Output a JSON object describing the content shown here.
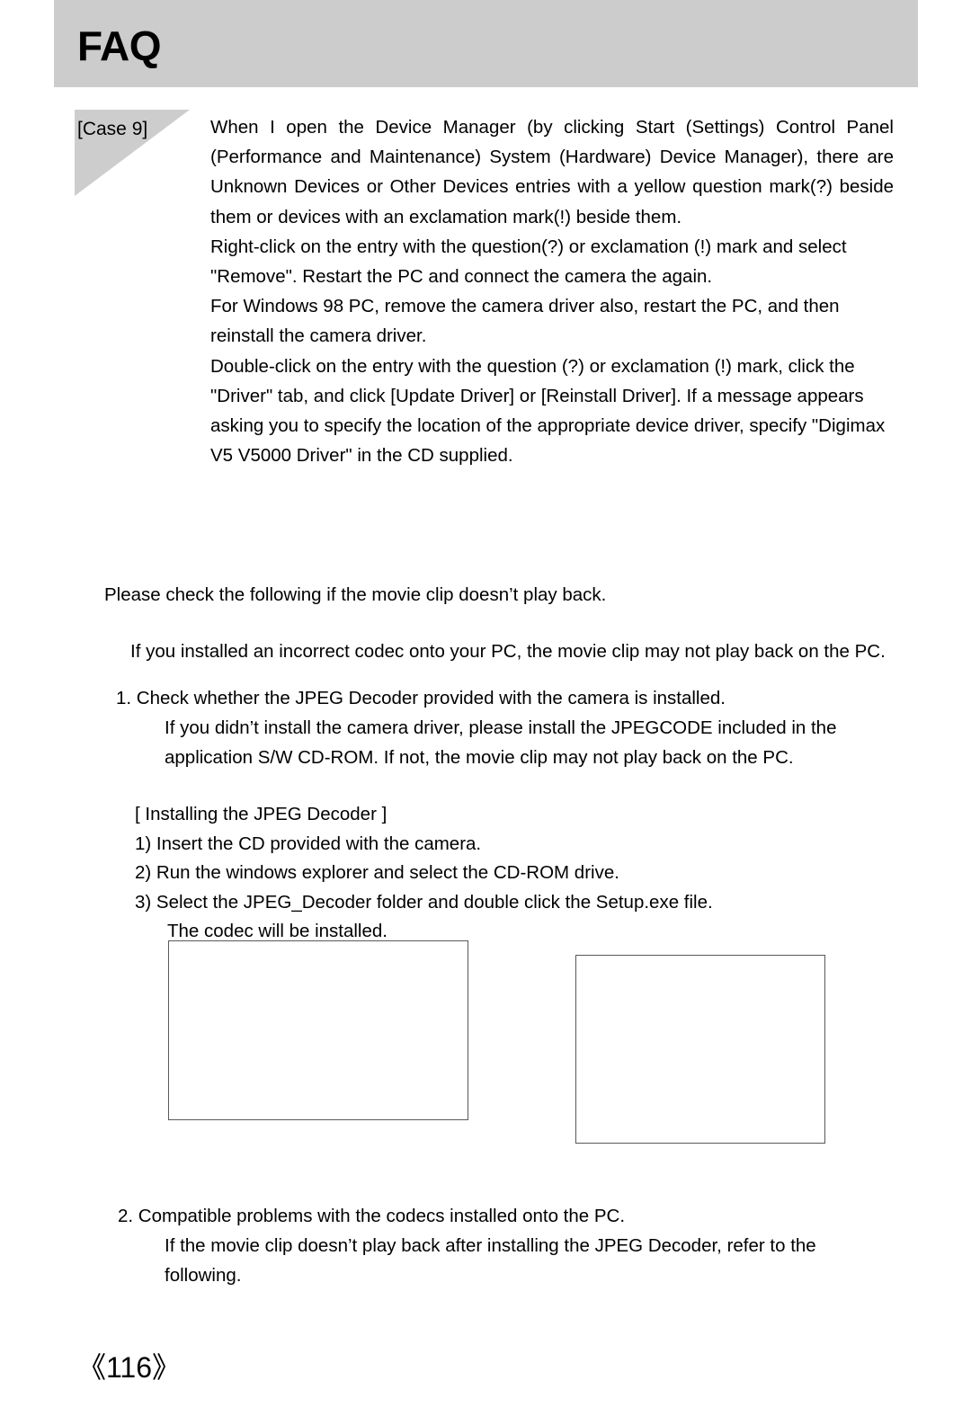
{
  "header": {
    "title": "FAQ",
    "band_color": "#cccccc"
  },
  "case": {
    "label": "[Case 9]",
    "marker_color": "#cdcdcd",
    "paragraphs": [
      "When I open the Device Manager (by clicking Start    (Settings)    Control Panel    (Performance and Maintenance)    System    (Hardware)    Device Manager), there are   Unknown Devices   or   Other Devices   entries with a yellow question mark(?) beside them or devices with an exclamation mark(!) beside them.",
      "Right-click on the entry with the question(?) or exclamation (!) mark and select \"Remove\". Restart the PC and connect the camera the again.",
      "For Windows 98 PC, remove the camera driver also, restart the PC, and then reinstall the camera driver.",
      "Double-click on the entry with the question (?) or exclamation (!) mark, click the \"Driver\" tab, and click [Update Driver] or [Reinstall Driver]. If a message appears asking you to specify the location of the appropriate device driver, specify \"Digimax V5 V5000 Driver\" in the CD supplied."
    ]
  },
  "movie_section": {
    "intro": "Please check the following if the movie clip doesn’t play back.",
    "note": "If you installed an incorrect codec onto your PC, the movie clip may not play back on the PC.",
    "item1": {
      "heading": "1. Check whether the JPEG Decoder provided with the camera is installed.",
      "body_lines": [
        "If you didn’t install the camera driver, please install the JPEGCODE included in the",
        "application S/W CD-ROM. If not, the movie clip may not play back on the PC."
      ]
    },
    "install_guide": {
      "heading": "[ Installing the JPEG Decoder ]",
      "steps": [
        "1) Insert the CD provided with the camera.",
        "2) Run the windows explorer and select the CD-ROM drive.",
        "3) Select the JPEG_Decoder folder and double click the Setup.exe file."
      ],
      "step3_continuation": "The codec will be installed."
    },
    "item2": {
      "heading": "2. Compatible problems with the codecs installed onto the PC.",
      "body_lines": [
        "If the movie clip doesn’t play back after installing the JPEG Decoder, refer to the",
        "following."
      ]
    }
  },
  "screenshots": {
    "left_caption": "",
    "right_caption": "",
    "border_color": "#595959"
  },
  "footer": {
    "page_number": "《116》"
  }
}
